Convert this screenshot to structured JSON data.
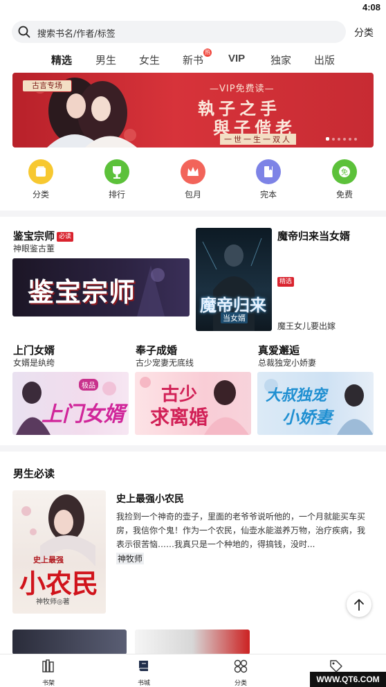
{
  "status": {
    "time": "4:08"
  },
  "search": {
    "placeholder": "搜索书名/作者/标签",
    "category_link": "分类"
  },
  "tabs": [
    {
      "label": "精选",
      "active": true
    },
    {
      "label": "男生"
    },
    {
      "label": "女生"
    },
    {
      "label": "新书",
      "badge": "热"
    },
    {
      "label": "VIP"
    },
    {
      "label": "独家"
    },
    {
      "label": "出版"
    }
  ],
  "banner": {
    "tag": "古言专场",
    "subtitle": "—VIP免费读—",
    "line1": "執子之手",
    "line2": "與子偕老",
    "tail": "一世一生一双人"
  },
  "quick": [
    {
      "label": "分类",
      "icon": "category-icon",
      "color": "#f7c830"
    },
    {
      "label": "排行",
      "icon": "trophy-icon",
      "color": "#5cc13a"
    },
    {
      "label": "包月",
      "icon": "crown-icon",
      "color": "#f2645a"
    },
    {
      "label": "完本",
      "icon": "book-complete-icon",
      "color": "#7d83e6"
    },
    {
      "label": "免费",
      "icon": "free-icon",
      "color": "#5cc13a"
    }
  ],
  "featured": {
    "left": {
      "title": "鉴宝宗师",
      "badge": "必读",
      "subtitle": "神眼鉴古董",
      "cover_text": "鉴宝宗师"
    },
    "right": {
      "title": "魔帝归来当女婿",
      "badge": "精选",
      "subtitle": "魔王女儿要出嫁",
      "cover_text": "魔帝归来",
      "cover_sub": "当女婿"
    }
  },
  "grid": [
    {
      "title": "上门女婿",
      "subtitle": "女婿是纨绔",
      "cover_text": "上门女婿",
      "cover_small": "极品"
    },
    {
      "title": "奉子成婚",
      "subtitle": "古少宠妻无底线",
      "cover_text": "古少",
      "cover_text2": "求离婚"
    },
    {
      "title": "真爱邂逅",
      "subtitle": "总裁独宠小娇妻",
      "cover_text": "大叔独宠",
      "cover_text2": "小娇妻"
    }
  ],
  "male_section": {
    "title": "男生必读",
    "book": {
      "title": "史上最强小农民",
      "desc": "我捡到一个神奇的壶子，里面的老爷爷说听他的，一个月就能买车买房，我信你个鬼！作为一个农民，仙壶水能滋养万物，治疗疾病，我表示很苦恼……我真只是一个种地的，得搞钱，没时...",
      "author": "神牧师",
      "cover_small": "史上最强",
      "cover_text": "小农民",
      "cover_author": "神牧师◎著"
    }
  },
  "bottom_nav": [
    {
      "label": "书架",
      "icon": "bookshelf-icon"
    },
    {
      "label": "书城",
      "icon": "bookstore-icon"
    },
    {
      "label": "分类",
      "icon": "grid-icon"
    },
    {
      "label": "",
      "icon": "tag-icon"
    }
  ],
  "watermark": "WWW.QT6.COM"
}
